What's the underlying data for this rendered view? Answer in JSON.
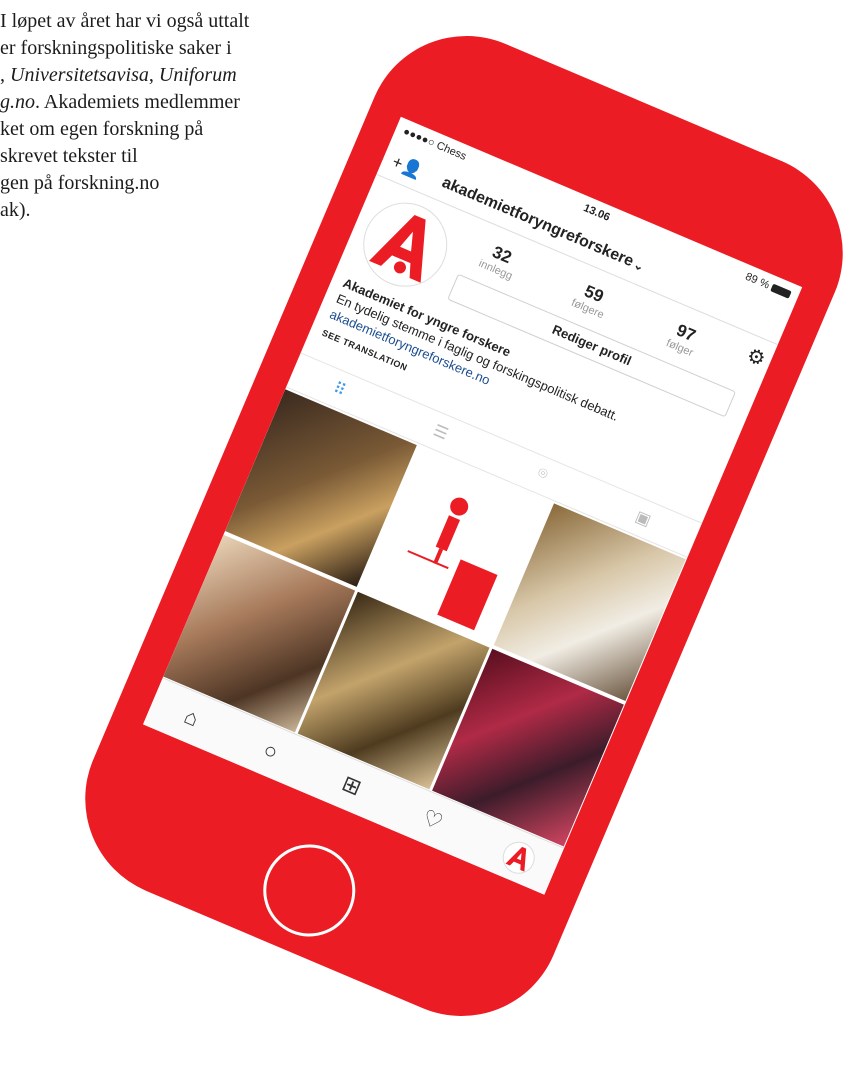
{
  "article": {
    "line1": "I løpet av året har vi også uttalt",
    "line2": "er forskningspolitiske saker i",
    "line3_pre": ", ",
    "line3_em1": "Universitetsavisa",
    "line3_mid": ", ",
    "line3_em2": "Uniforum",
    "line4_em": "g.no",
    "line4_rest": ". Akademiets medlemmer",
    "line5": "ket om egen forskning på",
    "line6": "skrevet tekster til",
    "line7": "gen på forskning.no",
    "line8": "ak)."
  },
  "status_bar": {
    "carrier": "●●●●○ Chess",
    "time": "13.06",
    "battery": "89 %"
  },
  "header": {
    "username": "akademietforyngreforskere",
    "dropdown_glyph": "⌄",
    "add_user_glyph": "+👤",
    "settings_glyph": "⚙"
  },
  "stats": [
    {
      "value": "32",
      "label": "innlegg"
    },
    {
      "value": "59",
      "label": "følgere"
    },
    {
      "value": "97",
      "label": "følger"
    }
  ],
  "edit_profile_label": "Rediger profil",
  "bio": {
    "name": "Akademiet for yngre forskere",
    "description": "En tydelig stemme i faglig og forskingspolitisk debatt.",
    "link": "akademietforyngreforskere.no",
    "see_translation": "SEE TRANSLATION"
  },
  "tabs": [
    {
      "name": "grid-view",
      "glyph": "⠿"
    },
    {
      "name": "list-view",
      "glyph": "☰"
    },
    {
      "name": "location",
      "glyph": "⌾"
    },
    {
      "name": "tagged",
      "glyph": "▣"
    }
  ],
  "bottom_nav": [
    {
      "name": "home",
      "glyph": "⌂"
    },
    {
      "name": "search",
      "glyph": "○"
    },
    {
      "name": "new-post",
      "glyph": "⊞"
    },
    {
      "name": "activity",
      "glyph": "♡"
    }
  ],
  "colors": {
    "brand_red": "#ec1c24",
    "link_blue": "#1a4d8f",
    "active_tab": "#3897f0"
  }
}
